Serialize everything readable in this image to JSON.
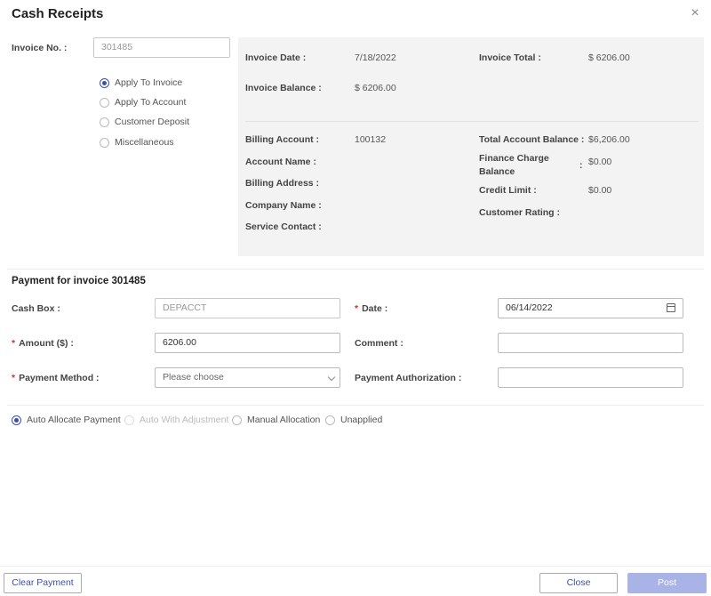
{
  "dialog": {
    "title": "Cash Receipts",
    "close_glyph": "×"
  },
  "invoice": {
    "label": "Invoice No. :",
    "value": "301485",
    "options": [
      "Apply To Invoice",
      "Apply To Account",
      "Customer Deposit",
      "Miscellaneous"
    ],
    "selected": 0
  },
  "details": {
    "invoice_date_label": "Invoice Date :",
    "invoice_date": "7/18/2022",
    "invoice_total_label": "Invoice Total :",
    "invoice_total": "$ 6206.00",
    "invoice_balance_label": "Invoice Balance :",
    "invoice_balance": "$ 6206.00",
    "billing_account_label": "Billing Account :",
    "billing_account": "100132",
    "account_name_label": "Account Name :",
    "billing_address_label": "Billing Address :",
    "company_name_label": "Company Name :",
    "service_contact_label": "Service Contact :",
    "total_account_balance_label": "Total Account Balance :",
    "total_account_balance": "$6,206.00",
    "finance_charge_label_1": "Finance Charge",
    "finance_charge_label_2": "Balance",
    "finance_charge_colon": ":",
    "finance_charge": "$0.00",
    "credit_limit_label": "Credit Limit :",
    "credit_limit": "$0.00",
    "customer_rating_label": "Customer Rating :"
  },
  "payment": {
    "section_title": "Payment for invoice 301485",
    "required_mark": "*",
    "cash_box_label": "Cash Box :",
    "cash_box": "DEPACCT",
    "date_label": "Date :",
    "date": "06/14/2022",
    "amount_label": "Amount ($) :",
    "amount": "6206.00",
    "comment_label": "Comment :",
    "comment": "",
    "method_label": "Payment Method :",
    "method_placeholder": "Please choose",
    "authorization_label": "Payment Authorization :",
    "authorization": ""
  },
  "allocation": {
    "options": [
      "Auto Allocate Payment",
      "Auto With Adjustment",
      "Manual Allocation",
      "Unapplied"
    ],
    "selected": 0
  },
  "footer": {
    "clear": "Clear Payment",
    "close": "Close",
    "post": "Post"
  }
}
